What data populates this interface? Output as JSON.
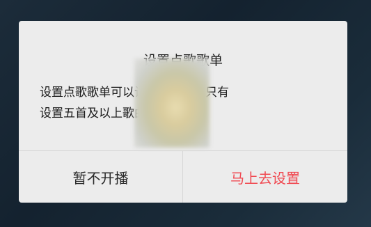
{
  "dialog": {
    "title": "设置点歌歌单",
    "message_line1": "设置点歌歌单可以让用户点歌，只有",
    "message_line2": "设置五首及以上歌曲才能开播哦",
    "cancel_label": "暂不开播",
    "confirm_label": "马上去设置"
  },
  "colors": {
    "confirm": "#f04a52",
    "dialog_bg": "#ececec"
  }
}
